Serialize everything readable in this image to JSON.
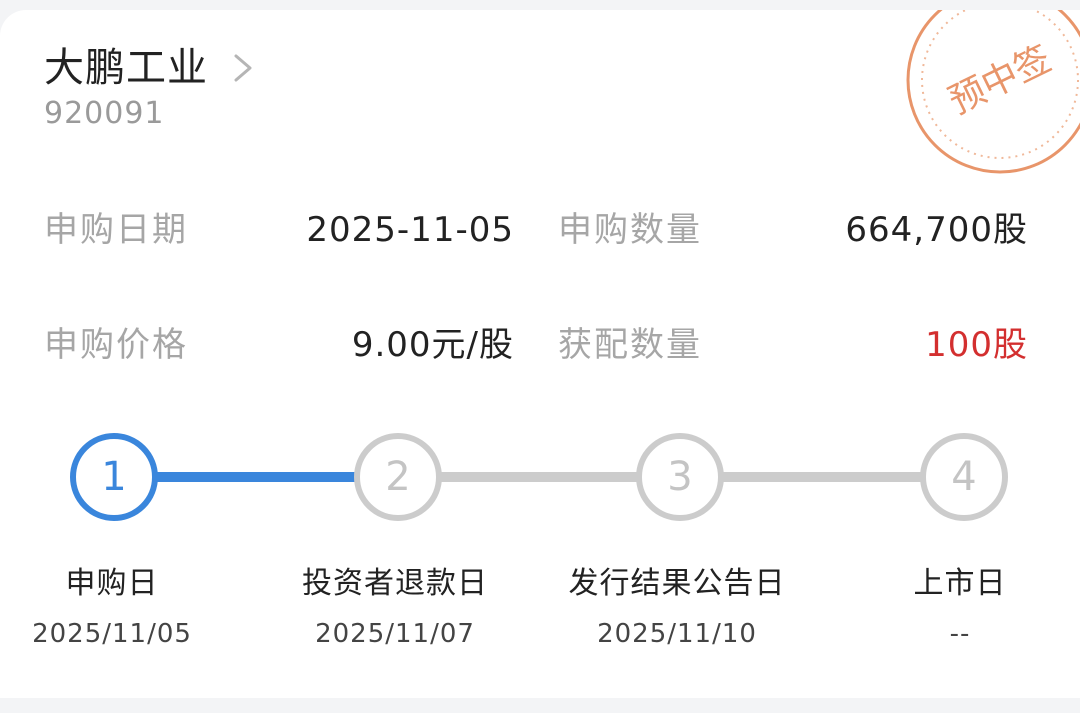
{
  "stock": {
    "name": "大鹏工业",
    "code": "920091",
    "stamp_text": "预中签"
  },
  "info": {
    "subscribe_date_label": "申购日期",
    "subscribe_date_value": "2025-11-05",
    "subscribe_qty_label": "申购数量",
    "subscribe_qty_value": "664,700股",
    "price_label": "申购价格",
    "price_value": "9.00元/股",
    "allotted_label": "获配数量",
    "allotted_value": "100股"
  },
  "steps": [
    {
      "number": "1",
      "label": "申购日",
      "date": "2025/11/05"
    },
    {
      "number": "2",
      "label": "投资者退款日",
      "date": "2025/11/07"
    },
    {
      "number": "3",
      "label": "发行结果公告日",
      "date": "2025/11/10"
    },
    {
      "number": "4",
      "label": "上市日",
      "date": "--"
    }
  ],
  "progress": {
    "current_step": 1,
    "total_steps": 4
  },
  "colors": {
    "accent_blue": "#3a86dc",
    "inactive_gray": "#cccccc",
    "stamp_orange": "#e8956a",
    "highlight_red": "#d32f2f"
  },
  "icons": {
    "chevron": "chevron-right-icon",
    "stamp": "stamp-seal-icon"
  }
}
